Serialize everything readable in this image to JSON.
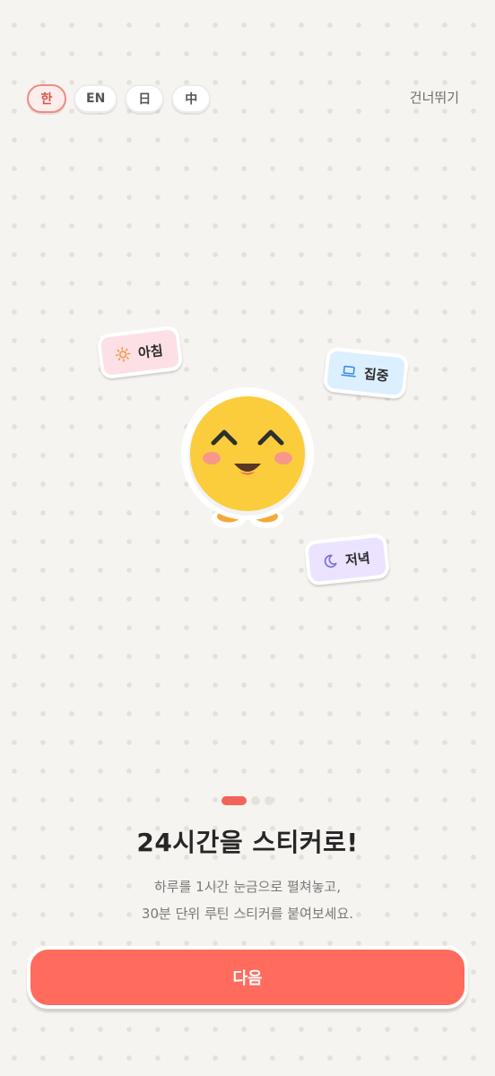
{
  "language_selector": {
    "items": [
      {
        "label": "한",
        "active": true
      },
      {
        "label": "EN",
        "active": false
      },
      {
        "label": "日",
        "active": false
      },
      {
        "label": "中",
        "active": false
      }
    ]
  },
  "header": {
    "skip_label": "건너뛰기"
  },
  "stickers": {
    "morning": {
      "label": "아침",
      "icon": "sun-icon",
      "color": "#fde0e5"
    },
    "focus": {
      "label": "집중",
      "icon": "laptop-icon",
      "color": "#dcefff"
    },
    "evening": {
      "label": "저녁",
      "icon": "moon-icon",
      "color": "#ebe3ff"
    }
  },
  "mascot": {
    "icon": "smiley-mascot",
    "face_color": "#fbcd3c"
  },
  "pager": {
    "total": 3,
    "current": 1
  },
  "content": {
    "title": "24시간을 스티커로!",
    "subtitle_line1": "하루를 1시간 눈금으로 펼쳐놓고,",
    "subtitle_line2": "30분 단위 루틴 스티커를 붙여보세요."
  },
  "footer": {
    "next_label": "다음"
  },
  "colors": {
    "accent": "#ff6b5d",
    "background": "#f6f4f0"
  }
}
